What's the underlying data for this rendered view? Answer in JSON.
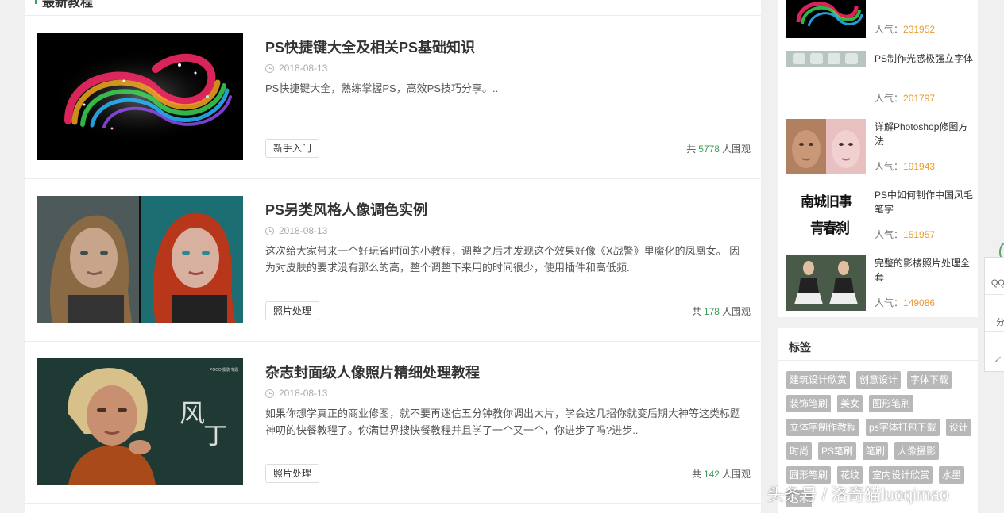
{
  "section": {
    "title": "最新教程"
  },
  "articles": [
    {
      "title": "PS快捷键大全及相关PS基础知识",
      "date": "2018-08-13",
      "desc": "PS快捷键大全，熟练掌握PS，高效PS技巧分享。..",
      "tag": "新手入门",
      "views_prefix": "共",
      "views": "5778",
      "views_suffix": "人围观"
    },
    {
      "title": "PS另类风格人像调色实例",
      "date": "2018-08-13",
      "desc": "这次给大家带来一个好玩省时间的小教程，调整之后才发现这个效果好像《X战警》里魔化的凤凰女。 因为对皮肤的要求没有那么的高，整个调整下来用的时间很少，使用插件和高低频..",
      "tag": "照片处理",
      "views_prefix": "共",
      "views": "178",
      "views_suffix": "人围观"
    },
    {
      "title": "杂志封面级人像照片精细处理教程",
      "date": "2018-08-13",
      "desc": "如果你想学真正的商业修图，就不要再迷信五分钟教你调出大片，学会这几招你就变后期大神等这类标题神叨的快餐教程了。你满世界搜快餐教程并且学了一个又一个，你进步了吗?进步..",
      "tag": "照片处理",
      "views_prefix": "共",
      "views": "142",
      "views_suffix": "人围观"
    }
  ],
  "thumb_text": {
    "poco": "POCO 摄影专题",
    "feng": "风",
    "ding": "丁"
  },
  "popular": [
    {
      "title": "",
      "views_label": "人气：",
      "views": "231952"
    },
    {
      "title": "PS制作光感极强立字体",
      "views_label": "人气：",
      "views": "201797"
    },
    {
      "title": "详解Photoshop修图方法",
      "views_label": "人气：",
      "views": "191943"
    },
    {
      "title": "PS中如何制作中国风毛笔字",
      "views_label": "人气：",
      "views": "151957",
      "calligraphy": [
        "南城旧事",
        "青春刹"
      ]
    },
    {
      "title": "完整的影楼照片处理全套",
      "views_label": "人气：",
      "views": "149086"
    }
  ],
  "tags_box": {
    "title": "标签",
    "tags": [
      "建筑设计欣赏",
      "创意设计",
      "字体下载",
      "装饰笔刷",
      "美女",
      "图形笔刷",
      "立体字制作教程",
      "ps字体打包下载",
      "设计",
      "时尚",
      "PS笔刷",
      "笔刷",
      "人像摄影",
      "圆形笔刷",
      "花纹",
      "室内设计欣赏",
      "水墨",
      "艺术"
    ]
  },
  "float_bar": {
    "items": [
      "QQ",
      "分",
      ""
    ]
  },
  "watermark": "头条号 / 洛奇猫luoqimao"
}
